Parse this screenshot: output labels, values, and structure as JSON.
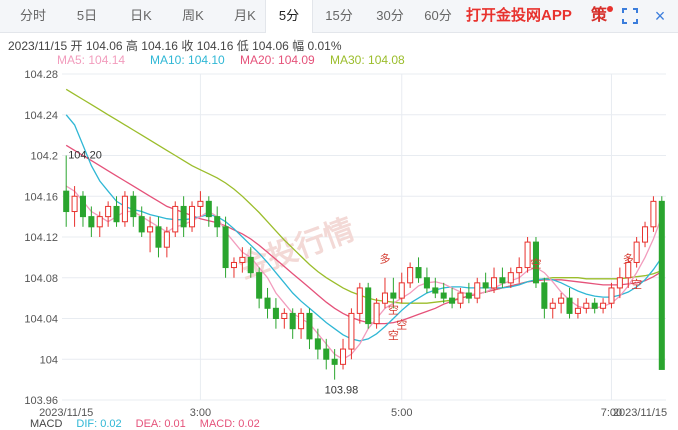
{
  "tabs": [
    "分时",
    "5日",
    "日K",
    "周K",
    "月K",
    "5分",
    "15分",
    "30分",
    "60分"
  ],
  "active_tab": 5,
  "app_link": "打开金投网APP",
  "strategy_label": "策",
  "close_icon": "×",
  "info": {
    "date": "2023/11/15",
    "open_label": "开",
    "open": "104.06",
    "high_label": "高",
    "high": "104.16",
    "close_label": "收",
    "close": "104.16",
    "low_label": "低",
    "low": "104.06",
    "amp_label": "幅",
    "amp": "0.01%"
  },
  "ma": [
    {
      "label": "MA5:",
      "value": "104.14",
      "color": "#f29cbd"
    },
    {
      "label": "MA10:",
      "value": "104.10",
      "color": "#2fb7d5"
    },
    {
      "label": "MA20:",
      "value": "104.09",
      "color": "#e5527a"
    },
    {
      "label": "MA30:",
      "value": "104.08",
      "color": "#9bbd2b"
    }
  ],
  "macd": [
    {
      "label": "MACD",
      "value": "",
      "color": "#444"
    },
    {
      "label": "DIF:",
      "value": "0.02",
      "color": "#2fb7d5"
    },
    {
      "label": "DEA:",
      "value": "0.01",
      "color": "#e5527a"
    },
    {
      "label": "MACD:",
      "value": "0.02",
      "color": "#e5527a"
    }
  ],
  "watermark": "金投行情",
  "colors": {
    "up": "#e8322e",
    "down": "#2aa52e",
    "grid": "#e8ecf1"
  },
  "chart_data": {
    "type": "candlestick",
    "yticks": [
      "104.28",
      "104.24",
      "104.2",
      "104.16",
      "104.12",
      "104.08",
      "104.04",
      "104",
      "103.96"
    ],
    "ylim": [
      103.96,
      104.28
    ],
    "xticks": [
      "2023/11/15",
      "3:00",
      "5:00",
      "7:00",
      "2023/11/15"
    ],
    "annotations": {
      "max_label": "104.20",
      "min_label": "103.98"
    },
    "trade_markers": [
      "多",
      "空",
      "空",
      "空",
      "空",
      "多",
      "空"
    ],
    "candles": [
      [
        104.165,
        104.2,
        104.13,
        104.145
      ],
      [
        104.145,
        104.17,
        104.13,
        104.16
      ],
      [
        104.16,
        104.165,
        104.13,
        104.14
      ],
      [
        104.14,
        104.15,
        104.12,
        104.13
      ],
      [
        104.13,
        104.145,
        104.12,
        104.14
      ],
      [
        104.14,
        104.155,
        104.13,
        104.15
      ],
      [
        104.15,
        104.16,
        104.13,
        104.135
      ],
      [
        104.135,
        104.165,
        104.13,
        104.16
      ],
      [
        104.16,
        104.165,
        104.13,
        104.14
      ],
      [
        104.14,
        104.15,
        104.12,
        104.125
      ],
      [
        104.125,
        104.14,
        104.105,
        104.13
      ],
      [
        104.13,
        104.14,
        104.1,
        104.11
      ],
      [
        104.11,
        104.13,
        104.1,
        104.125
      ],
      [
        104.125,
        104.155,
        104.12,
        104.15
      ],
      [
        104.15,
        104.16,
        104.12,
        104.13
      ],
      [
        104.13,
        104.155,
        104.125,
        104.15
      ],
      [
        104.15,
        104.165,
        104.14,
        104.155
      ],
      [
        104.155,
        104.16,
        104.13,
        104.14
      ],
      [
        104.14,
        104.15,
        104.12,
        104.13
      ],
      [
        104.13,
        104.14,
        104.08,
        104.09
      ],
      [
        104.09,
        104.1,
        104.08,
        104.095
      ],
      [
        104.095,
        104.11,
        104.085,
        104.1
      ],
      [
        104.1,
        104.11,
        104.08,
        104.085
      ],
      [
        104.085,
        104.09,
        104.05,
        104.06
      ],
      [
        104.06,
        104.07,
        104.04,
        104.05
      ],
      [
        104.05,
        104.06,
        104.03,
        104.04
      ],
      [
        104.04,
        104.05,
        104.03,
        104.045
      ],
      [
        104.045,
        104.05,
        104.02,
        104.03
      ],
      [
        104.03,
        104.05,
        104.02,
        104.045
      ],
      [
        104.045,
        104.05,
        104.01,
        104.02
      ],
      [
        104.02,
        104.03,
        104.0,
        104.01
      ],
      [
        104.01,
        104.02,
        103.99,
        104.0
      ],
      [
        104.0,
        104.01,
        103.98,
        103.995
      ],
      [
        103.995,
        104.02,
        103.99,
        104.01
      ],
      [
        104.01,
        104.05,
        104.0,
        104.045
      ],
      [
        104.045,
        104.075,
        104.035,
        104.07
      ],
      [
        104.07,
        104.075,
        104.03,
        104.035
      ],
      [
        104.035,
        104.06,
        104.03,
        104.055
      ],
      [
        104.055,
        104.08,
        104.05,
        104.065
      ],
      [
        104.065,
        104.08,
        104.05,
        104.06
      ],
      [
        104.06,
        104.085,
        104.055,
        104.075
      ],
      [
        104.075,
        104.095,
        104.07,
        104.09
      ],
      [
        104.09,
        104.1,
        104.075,
        104.08
      ],
      [
        104.08,
        104.09,
        104.065,
        104.07
      ],
      [
        104.07,
        104.08,
        104.06,
        104.065
      ],
      [
        104.065,
        104.075,
        104.055,
        104.06
      ],
      [
        104.06,
        104.07,
        104.05,
        104.055
      ],
      [
        104.055,
        104.07,
        104.05,
        104.065
      ],
      [
        104.065,
        104.075,
        104.055,
        104.06
      ],
      [
        104.06,
        104.08,
        104.055,
        104.075
      ],
      [
        104.075,
        104.085,
        104.065,
        104.07
      ],
      [
        104.07,
        104.09,
        104.065,
        104.08
      ],
      [
        104.08,
        104.09,
        104.07,
        104.075
      ],
      [
        104.075,
        104.09,
        104.07,
        104.085
      ],
      [
        104.085,
        104.1,
        104.075,
        104.09
      ],
      [
        104.09,
        104.12,
        104.085,
        104.115
      ],
      [
        104.115,
        104.12,
        104.07,
        104.075
      ],
      [
        104.075,
        104.08,
        104.04,
        104.05
      ],
      [
        104.05,
        104.06,
        104.04,
        104.055
      ],
      [
        104.055,
        104.065,
        104.045,
        104.06
      ],
      [
        104.06,
        104.07,
        104.04,
        104.045
      ],
      [
        104.045,
        104.06,
        104.04,
        104.05
      ],
      [
        104.05,
        104.06,
        104.045,
        104.055
      ],
      [
        104.055,
        104.06,
        104.045,
        104.05
      ],
      [
        104.05,
        104.06,
        104.045,
        104.055
      ],
      [
        104.055,
        104.075,
        104.05,
        104.07
      ],
      [
        104.07,
        104.09,
        104.06,
        104.08
      ],
      [
        104.08,
        104.1,
        104.07,
        104.095
      ],
      [
        104.095,
        104.12,
        104.09,
        104.115
      ],
      [
        104.115,
        104.135,
        104.11,
        104.13
      ],
      [
        104.13,
        104.16,
        104.125,
        104.155
      ],
      [
        104.155,
        104.16,
        103.99,
        103.99
      ]
    ],
    "ma5": [
      104.17,
      104.165,
      104.155,
      104.145,
      104.14,
      104.135,
      104.14,
      104.145,
      104.145,
      104.14,
      104.135,
      104.13,
      104.125,
      104.13,
      104.132,
      104.136,
      104.14,
      104.145,
      104.14,
      104.125,
      104.115,
      104.105,
      104.1,
      104.09,
      104.08,
      104.065,
      104.055,
      104.045,
      104.04,
      104.035,
      104.025,
      104.015,
      104.005,
      104.0,
      104.005,
      104.015,
      104.03,
      104.04,
      104.05,
      104.055,
      104.06,
      104.065,
      104.072,
      104.075,
      104.076,
      104.074,
      104.07,
      104.066,
      104.064,
      104.064,
      104.066,
      104.07,
      104.074,
      104.077,
      104.08,
      104.087,
      104.09,
      104.085,
      104.076,
      104.066,
      104.058,
      104.052,
      104.05,
      104.05,
      104.052,
      104.055,
      104.062,
      104.072,
      104.085,
      104.1,
      104.118,
      104.14
    ],
    "ma10": [
      104.24,
      104.23,
      104.21,
      104.19,
      104.175,
      104.165,
      104.155,
      104.15,
      104.147,
      104.145,
      104.142,
      104.14,
      104.138,
      104.137,
      104.137,
      104.138,
      104.14,
      104.142,
      104.14,
      104.135,
      104.128,
      104.12,
      104.112,
      104.104,
      104.095,
      104.085,
      104.075,
      104.065,
      104.057,
      104.05,
      104.043,
      104.036,
      104.03,
      104.024,
      104.02,
      104.018,
      104.02,
      104.025,
      104.032,
      104.04,
      104.048,
      104.055,
      104.06,
      104.065,
      104.068,
      104.07,
      104.071,
      104.071,
      104.07,
      104.07,
      104.07,
      104.07,
      104.07,
      104.071,
      104.073,
      104.076,
      104.078,
      104.079,
      104.078,
      104.075,
      104.071,
      104.067,
      104.064,
      104.062,
      104.061,
      104.061,
      104.063,
      104.066,
      104.071,
      104.078,
      104.088,
      104.1
    ],
    "ma20": [
      104.21,
      104.205,
      104.2,
      104.195,
      104.19,
      104.185,
      104.18,
      104.175,
      104.17,
      104.165,
      104.16,
      104.155,
      104.15,
      104.147,
      104.144,
      104.141,
      104.138,
      104.136,
      104.134,
      104.131,
      104.127,
      104.123,
      104.118,
      104.112,
      104.105,
      104.098,
      104.091,
      104.084,
      104.077,
      104.07,
      104.063,
      104.056,
      104.05,
      104.045,
      104.041,
      104.038,
      104.036,
      104.035,
      104.035,
      104.036,
      104.038,
      104.041,
      104.044,
      104.047,
      104.05,
      104.054,
      104.057,
      104.06,
      104.062,
      104.064,
      104.066,
      104.068,
      104.07,
      104.072,
      104.074,
      104.076,
      104.077,
      104.078,
      104.078,
      104.078,
      104.077,
      104.076,
      104.075,
      104.074,
      104.073,
      104.073,
      104.073,
      104.074,
      104.075,
      104.077,
      104.081,
      104.086
    ],
    "ma30": [
      104.265,
      104.26,
      104.255,
      104.25,
      104.245,
      104.24,
      104.235,
      104.23,
      104.225,
      104.22,
      104.215,
      104.21,
      104.205,
      104.2,
      104.195,
      104.19,
      104.186,
      104.182,
      104.178,
      104.173,
      104.167,
      104.16,
      104.152,
      104.144,
      104.135,
      104.126,
      104.117,
      104.109,
      104.101,
      104.093,
      104.086,
      104.08,
      104.075,
      104.07,
      104.066,
      104.063,
      104.06,
      104.058,
      104.057,
      104.056,
      104.055,
      104.055,
      104.055,
      104.055,
      104.056,
      104.057,
      104.058,
      104.06,
      104.062,
      104.064,
      104.066,
      104.068,
      104.07,
      104.072,
      104.074,
      104.076,
      104.078,
      104.079,
      104.08,
      104.08,
      104.08,
      104.08,
      104.079,
      104.079,
      104.079,
      104.079,
      104.079,
      104.08,
      104.081,
      104.082,
      104.084,
      104.087
    ]
  }
}
